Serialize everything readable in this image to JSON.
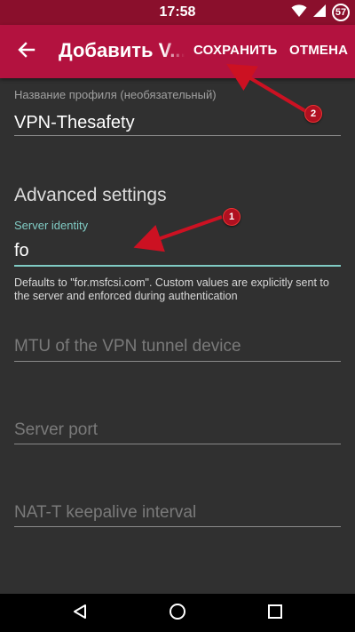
{
  "status_bar": {
    "time": "17:58",
    "battery_level": "57",
    "icons": [
      "wifi-icon",
      "signal-icon",
      "battery-icon"
    ]
  },
  "app_bar": {
    "title": "Добавить V...",
    "save_label": "СОХРАНИТЬ",
    "cancel_label": "ОТМЕНА",
    "back_icon": "arrow-back-icon"
  },
  "form": {
    "profile_name": {
      "label": "Название профиля (необязательный)",
      "value": "VPN-Thesafety"
    },
    "advanced_title": "Advanced settings",
    "server_identity": {
      "label": "Server identity",
      "value": "fo",
      "helper": "Defaults to \"for.msfcsi.com\". Custom values are explicitly sent to the server and enforced during authentication"
    },
    "mtu": {
      "hint": "MTU of the VPN tunnel device"
    },
    "server_port": {
      "hint": "Server port"
    },
    "natt_keepalive": {
      "hint": "NAT-T keepalive interval"
    }
  },
  "annotations": {
    "badge_1": "1",
    "badge_2": "2"
  },
  "nav_bar": {
    "icons": [
      "back-triangle-icon",
      "home-circle-icon",
      "recents-square-icon"
    ]
  },
  "colors": {
    "status_bar": "#8a0f2c",
    "app_bar": "#b3123f",
    "background": "#303030",
    "accent_teal": "#80cbc4",
    "annotation_red": "#cc1122"
  }
}
